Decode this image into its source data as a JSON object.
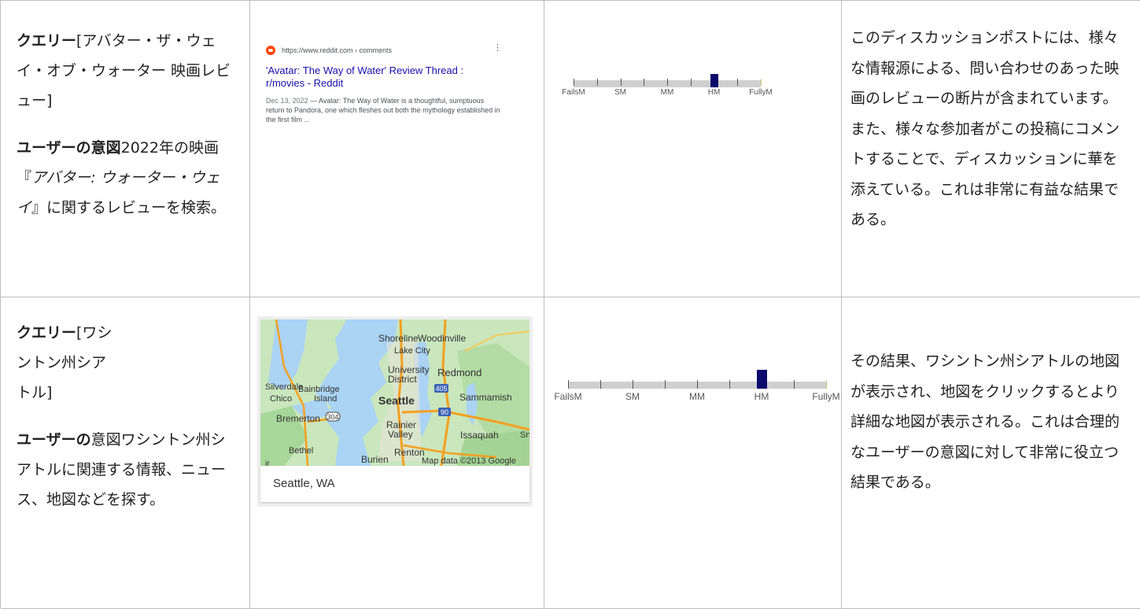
{
  "rows": [
    {
      "query_label": "クエリー",
      "query_text": "[アバター・ザ・ウェイ・オブ・ウォーター 映画レビュー]",
      "intent_label": "ユーザーの意図",
      "intent_prefix": "2022年の映画『",
      "intent_title": "アバター: ウォーター・ウェイ",
      "intent_suffix": "』に関するレビューを検索。",
      "result": {
        "url": "https://www.reddit.com › comments",
        "title": "'Avatar: The Way of Water' Review Thread : r/movies - Reddit",
        "date": "Dec 13, 2022",
        "snippet": " — Avatar: The Way of Water is a thoughtful, sumptuous return to Pandora, one which fleshes out both the mythology established in the first film ..."
      },
      "rating": {
        "labels": [
          "FailsM",
          "SM",
          "MM",
          "HM",
          "FullyM"
        ],
        "value": "HM"
      },
      "description": "このディスカッションポストには、様々な情報源による、問い合わせのあった映画のレビューの断片が含まれています。また、様々な参加者がこの投稿にコメントすることで、ディスカッションに華を添えている。これは非常に有益な結果である。"
    },
    {
      "query_label": "クエリー",
      "query_text": "[ワシントン州シアトル]",
      "intent_label": "ユーザーの",
      "intent_text": "意図ワシントン州シアトルに関連する情報、ニュース、地図などを探す。",
      "map": {
        "caption": "Seattle, WA",
        "attribution": "Map data ©2013 Google",
        "places": [
          "Shoreline",
          "Woodinville",
          "Lake City",
          "University District",
          "Redmond",
          "Silverdale",
          "Bainbridge Island",
          "Chico",
          "Seattle",
          "Sammamish",
          "Bremerton",
          "Rainier Valley",
          "Issaquah",
          "Bethel",
          "Renton",
          "Burien",
          "Sn",
          "ir"
        ],
        "highways": [
          "405",
          "304",
          "90"
        ]
      },
      "rating": {
        "labels": [
          "FailsM",
          "SM",
          "MM",
          "HM",
          "FullyM"
        ],
        "value": "HM"
      },
      "description": "その結果、ワシントン州シアトルの地図が表示され、地図をクリックするとより詳細な地図が表示される。これは合理的なユーザーの意図に対して非常に役立つ結果である。"
    }
  ],
  "colors": {
    "border": "#bdbdbd",
    "link": "#1a0dab",
    "marker": "#0b0b6e",
    "track": "#cfcfcf",
    "reddit": "#ff4500"
  }
}
